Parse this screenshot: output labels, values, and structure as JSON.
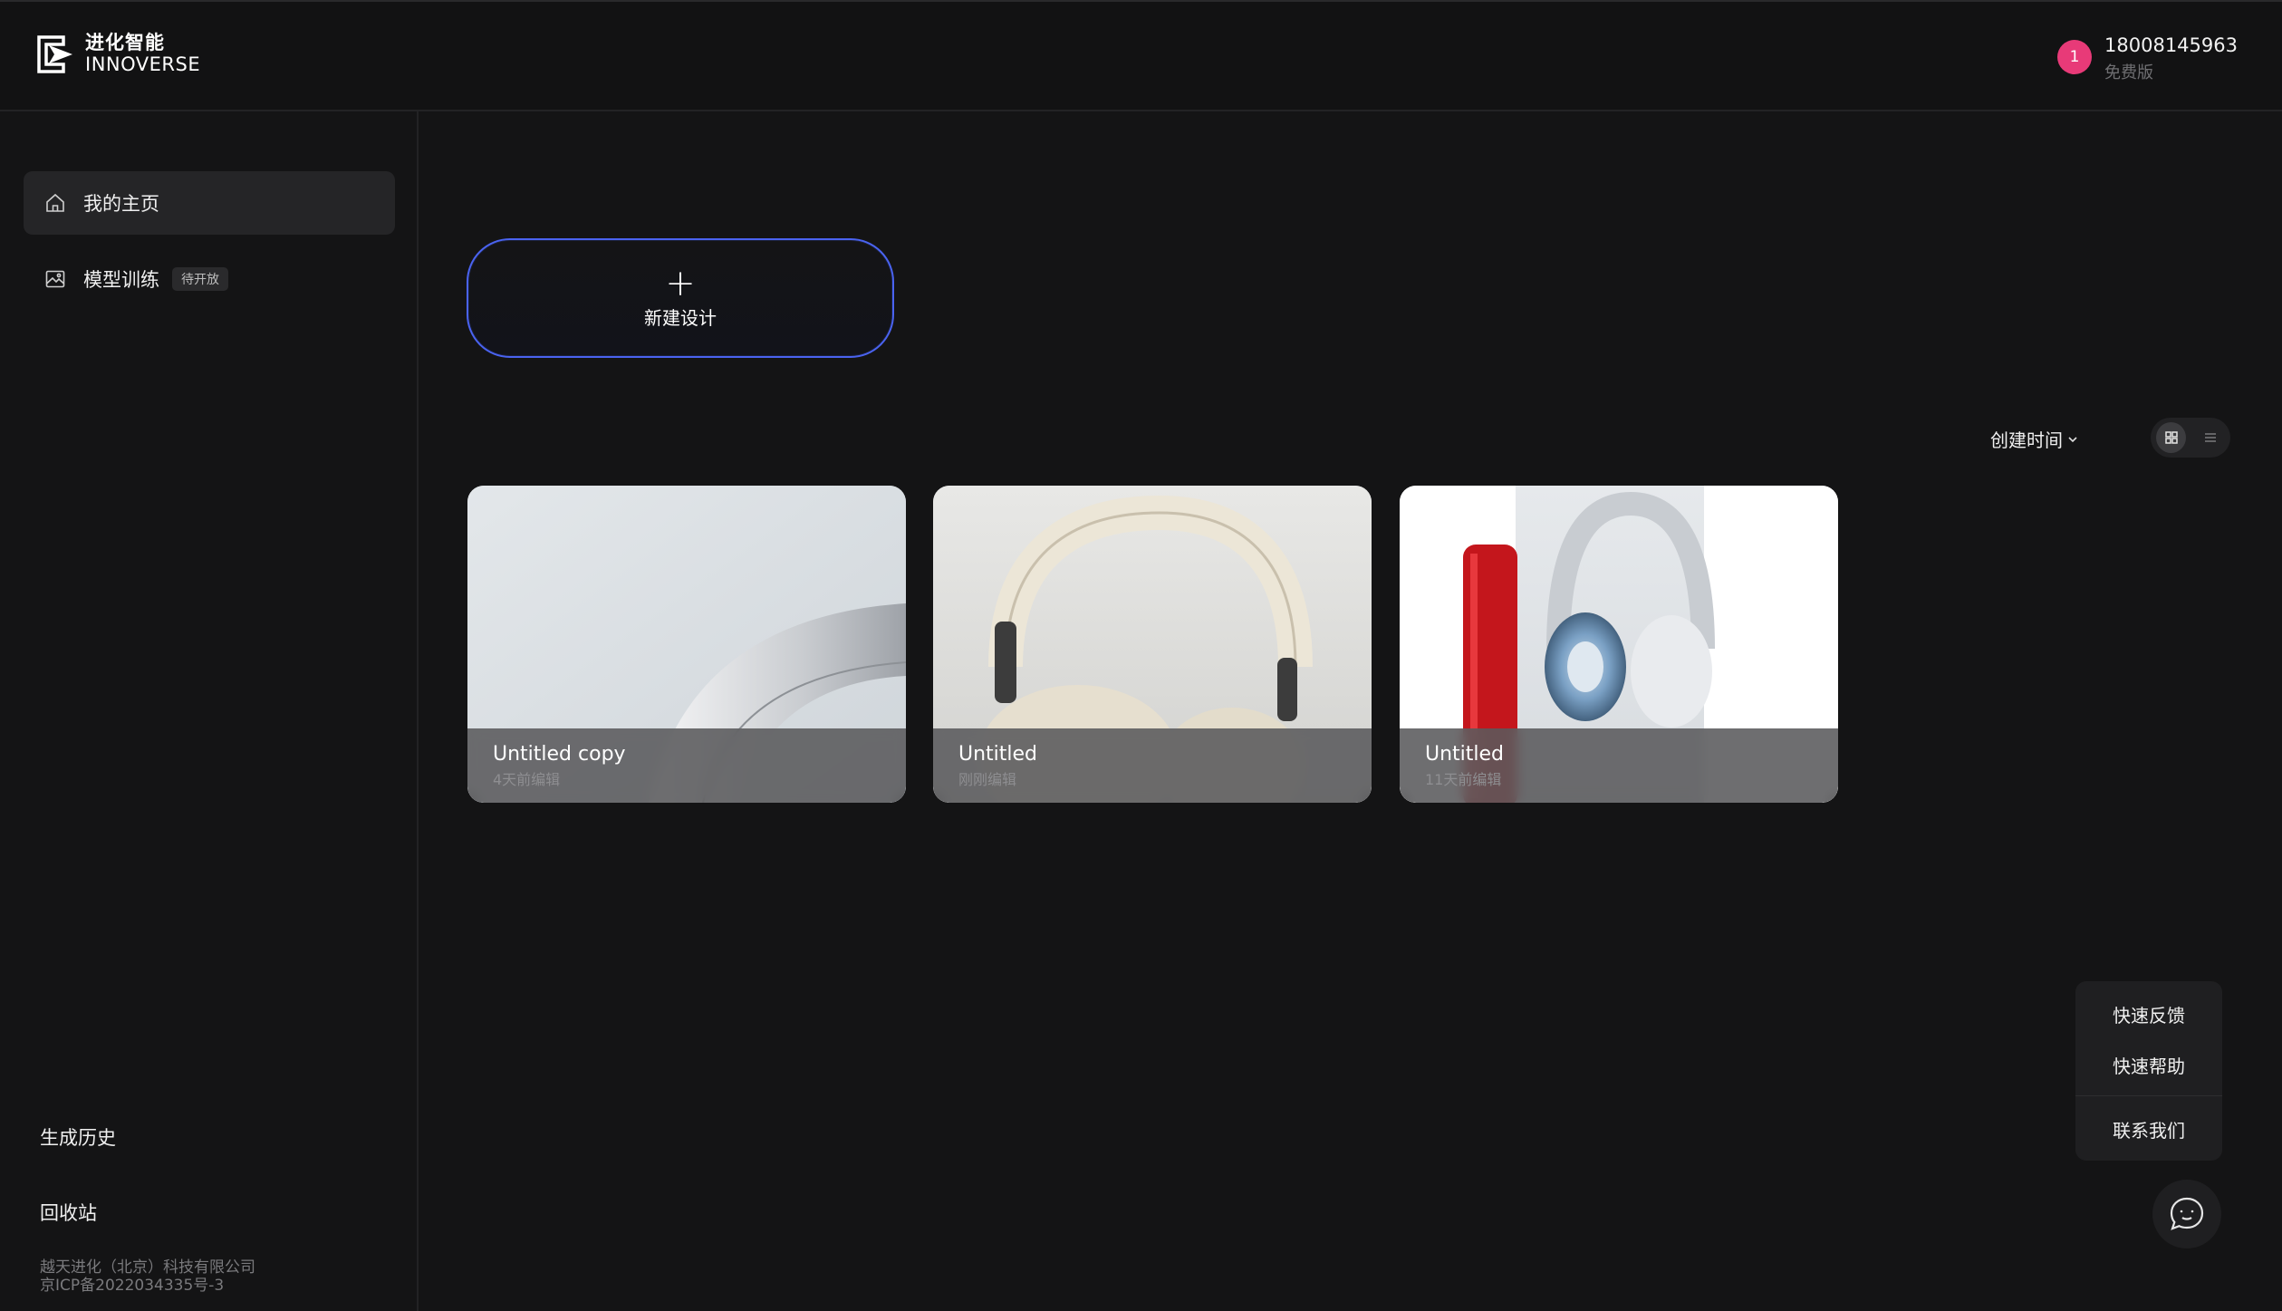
{
  "header": {
    "logo_cn": "进化智能",
    "logo_en": "INNOVERSE",
    "user": {
      "avatar_text": "1",
      "phone": "18008145963",
      "plan": "免费版"
    }
  },
  "sidebar": {
    "items": [
      {
        "label": "我的主页",
        "icon": "home-icon",
        "active": true
      },
      {
        "label": "模型训练",
        "icon": "image-frame-icon",
        "badge": "待开放",
        "active": false
      }
    ],
    "history_label": "生成历史",
    "trash_label": "回收站",
    "footer": {
      "company": "越天进化（北京）科技有限公司",
      "icp": "京ICP备2022034335号-3"
    }
  },
  "main": {
    "new_design": {
      "plus": "+",
      "label": "新建设计"
    },
    "sort": {
      "label": "创建时间",
      "icon": "chevron-down-icon"
    },
    "view_toggle": {
      "active": "grid",
      "options": [
        "grid-icon",
        "list-icon"
      ]
    },
    "cards": [
      {
        "title": "Untitled copy",
        "time": "4天前编辑"
      },
      {
        "title": "Untitled",
        "time": "刚刚编辑"
      },
      {
        "title": "Untitled",
        "time": "11天前编辑"
      }
    ]
  },
  "help": {
    "feedback": "快速反馈",
    "help": "快速帮助",
    "contact": "联系我们",
    "chat_icon": "chat-bubble-icon"
  },
  "colors": {
    "background": "#141415",
    "accent_border": "#4a63f0",
    "avatar": "#e83a78"
  }
}
